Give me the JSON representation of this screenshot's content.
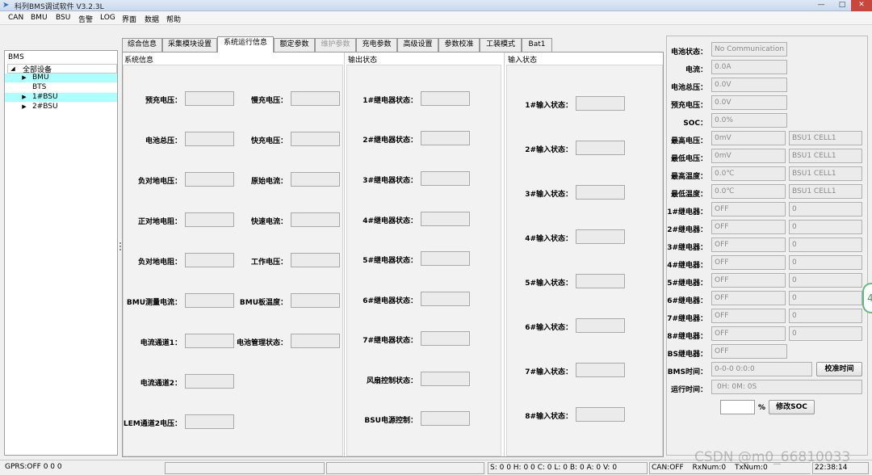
{
  "window": {
    "title": "科列BMS调试软件 V3.2.3L",
    "min_glyph": "—",
    "max_glyph": "□",
    "close_glyph": "✕"
  },
  "menu": [
    "CAN",
    "BMU",
    "BSU",
    "告警",
    "LOG",
    "界面",
    "数据",
    "帮助"
  ],
  "tree": {
    "header": "BMS",
    "root": "全部设备",
    "items": [
      {
        "label": "BMU",
        "arrow": "▶",
        "highlight": true
      },
      {
        "label": "BTS",
        "arrow": "",
        "highlight": false
      },
      {
        "label": "1#BSU",
        "arrow": "▶",
        "highlight": true
      },
      {
        "label": "2#BSU",
        "arrow": "▶",
        "highlight": false
      }
    ],
    "root_arrow": "◢"
  },
  "tabs": [
    {
      "label": "综合信息",
      "active": false,
      "disabled": false
    },
    {
      "label": "采集模块设置",
      "active": false,
      "disabled": false
    },
    {
      "label": "系统运行信息",
      "active": true,
      "disabled": false
    },
    {
      "label": "额定参数",
      "active": false,
      "disabled": false
    },
    {
      "label": "维护参数",
      "active": false,
      "disabled": true
    },
    {
      "label": "充电参数",
      "active": false,
      "disabled": false
    },
    {
      "label": "高级设置",
      "active": false,
      "disabled": false
    },
    {
      "label": "参数校准",
      "active": false,
      "disabled": false
    },
    {
      "label": "工装模式",
      "active": false,
      "disabled": false
    },
    {
      "label": "Bat1",
      "active": false,
      "disabled": false
    }
  ],
  "system_info": {
    "title": "系统信息",
    "left_fields": [
      "预充电压：",
      "电池总压：",
      "负对地电压：",
      "正对地电阻：",
      "负对地电阻：",
      "BMU测量电流：",
      "电流通道1：",
      "电流通道2：",
      "LEM通道2电压："
    ],
    "right_fields": [
      "慢充电压：",
      "快充电压：",
      "原始电流：",
      "快速电流：",
      "工作电压：",
      "BMU板温度：",
      "电池管理状态："
    ]
  },
  "output_status": {
    "title": "输出状态",
    "fields": [
      "1#继电器状态：",
      "2#继电器状态：",
      "3#继电器状态：",
      "4#继电器状态：",
      "5#继电器状态：",
      "6#继电器状态：",
      "7#继电器状态：",
      "风扇控制状态：",
      "BSU电源控制："
    ]
  },
  "input_status": {
    "title": "输入状态",
    "fields": [
      "1#输入状态：",
      "2#输入状态：",
      "3#输入状态：",
      "4#输入状态：",
      "5#输入状态：",
      "6#输入状态：",
      "7#输入状态：",
      "8#输入状态："
    ]
  },
  "right_panel": {
    "rows": [
      {
        "label": "电池状态：",
        "value": "No Communication",
        "extra": null
      },
      {
        "label": "电流：",
        "value": "0.0A",
        "extra": null
      },
      {
        "label": "电池总压：",
        "value": "0.0V",
        "extra": null
      },
      {
        "label": "预充电压：",
        "value": "0.0V",
        "extra": null
      },
      {
        "label": "SOC：",
        "value": "0.0%",
        "extra": null
      },
      {
        "label": "最高电压：",
        "value": "0mV",
        "extra": "BSU1 CELL1"
      },
      {
        "label": "最低电压：",
        "value": "0mV",
        "extra": "BSU1 CELL1"
      },
      {
        "label": "最高温度：",
        "value": "0.0℃",
        "extra": "BSU1 CELL1"
      },
      {
        "label": "最低温度：",
        "value": "0.0℃",
        "extra": "BSU1 CELL1"
      },
      {
        "label": "1#继电器：",
        "value": "OFF",
        "extra": "0"
      },
      {
        "label": "2#继电器：",
        "value": "OFF",
        "extra": "0"
      },
      {
        "label": "3#继电器：",
        "value": "OFF",
        "extra": "0"
      },
      {
        "label": "4#继电器：",
        "value": "OFF",
        "extra": "0"
      },
      {
        "label": "5#继电器：",
        "value": "OFF",
        "extra": "0"
      },
      {
        "label": "6#继电器：",
        "value": "OFF",
        "extra": "0"
      },
      {
        "label": "7#继电器：",
        "value": "OFF",
        "extra": "0"
      },
      {
        "label": "8#继电器：",
        "value": "OFF",
        "extra": "0"
      },
      {
        "label": "BS继电器：",
        "value": "OFF",
        "extra": null
      }
    ],
    "bms_time_label": "BMS时间：",
    "bms_time_value": "0-0-0 0:0:0",
    "calibrate_time_button": "校准时间",
    "run_time_label": "运行时间：",
    "run_time_value": "0H: 0M: 0S",
    "soc_percent_sign": "%",
    "modify_soc_button": "修改SOC"
  },
  "statusbar": {
    "gprs": "GPRS:OFF  0  0  0",
    "counters": "S:  0 0 H:  0 0 C:  0 L:  0 B:  0 A:  0 V:  0",
    "can": "CAN:OFF",
    "rx": "RxNum:0",
    "tx": "TxNum:0",
    "clock": "22:38:14"
  },
  "watermark": "CSDN @m0_66810033",
  "side_badge": "4"
}
